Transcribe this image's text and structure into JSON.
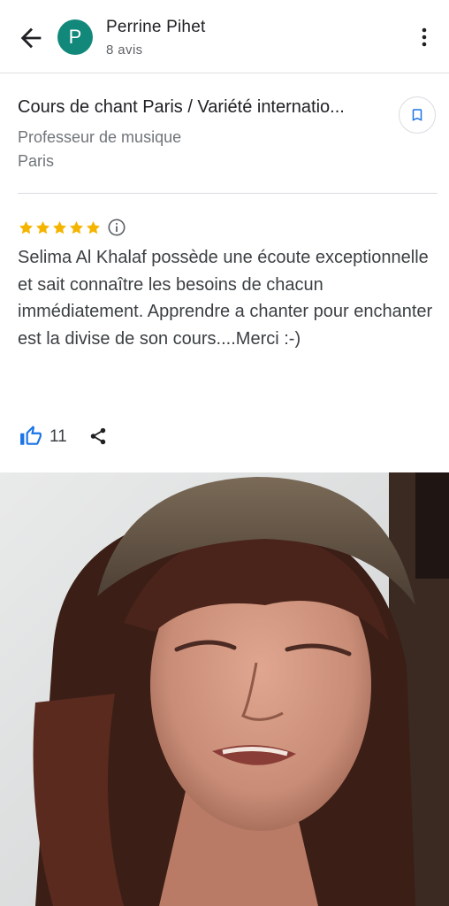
{
  "header": {
    "avatar_letter": "P",
    "reviewer_name": "Perrine Pihet",
    "reviewer_review_count": "8 avis"
  },
  "place": {
    "name": "Cours de chant Paris / Variété internatio...",
    "category": "Professeur de musique",
    "city": "Paris"
  },
  "review": {
    "rating": 5,
    "text": "Selima Al Khalaf possède une écoute exceptionnelle et sait connaître les besoins de chacun immédiatement. Apprendre a chanter pour enchanter est la divise de son cours....Merci :-)",
    "likes": "11"
  },
  "colors": {
    "avatar": "#12887b",
    "star": "#f5b400",
    "like": "#1a73e8",
    "save": "#1a73e8"
  }
}
